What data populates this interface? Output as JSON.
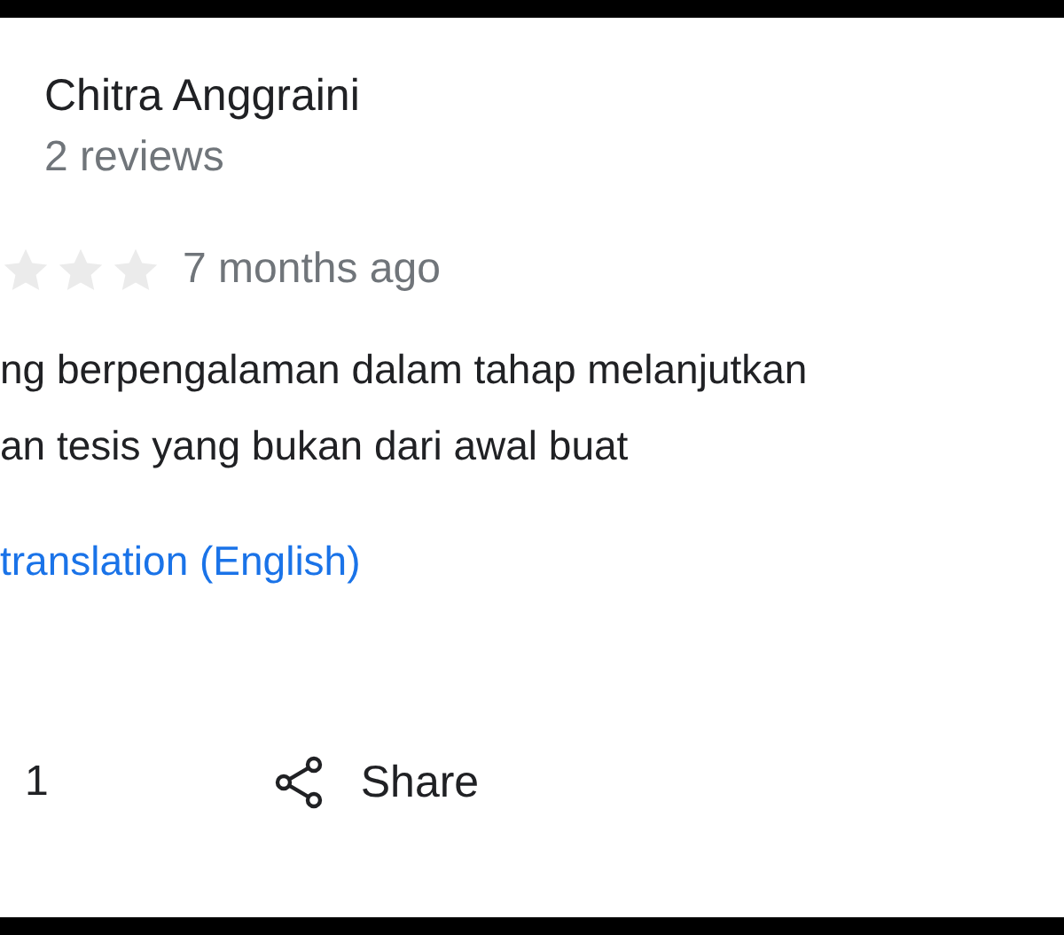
{
  "reviewer": {
    "name": "Chitra Anggraini",
    "reviews": "2 reviews"
  },
  "review": {
    "time": "7 months ago",
    "lines": [
      "ng berpengalaman dalam tahap melanjutkan",
      "an tesis yang bukan dari awal buat"
    ],
    "translation_link": "translation (English)"
  },
  "actions": {
    "like_count": "1",
    "share": "Share"
  }
}
